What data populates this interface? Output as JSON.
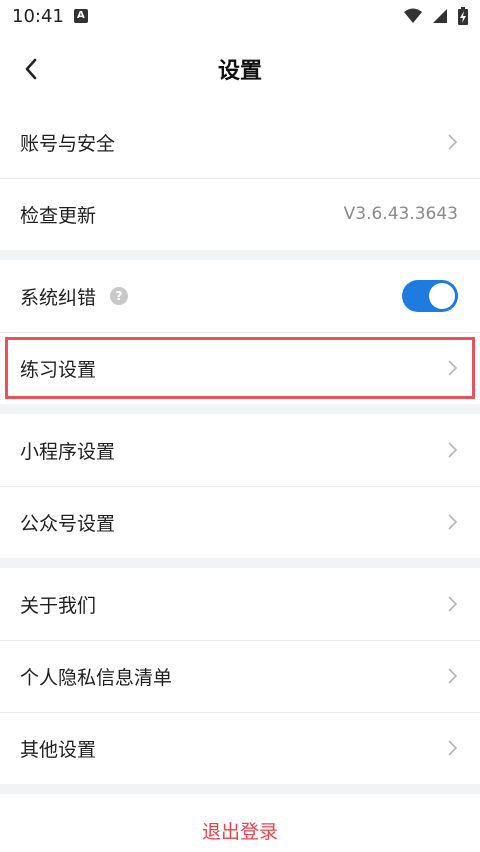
{
  "status_bar": {
    "time": "10:41",
    "notification_badge": "A"
  },
  "header": {
    "title": "设置"
  },
  "groups": [
    {
      "items": [
        {
          "label": "账号与安全",
          "type": "link"
        },
        {
          "label": "检查更新",
          "type": "value",
          "value": "V3.6.43.3643"
        }
      ]
    },
    {
      "items": [
        {
          "label": "系统纠错",
          "type": "toggle",
          "enabled": true,
          "help": "?"
        },
        {
          "label": "练习设置",
          "type": "link",
          "highlighted": true
        }
      ]
    },
    {
      "items": [
        {
          "label": "小程序设置",
          "type": "link"
        },
        {
          "label": "公众号设置",
          "type": "link"
        }
      ]
    },
    {
      "items": [
        {
          "label": "关于我们",
          "type": "link"
        },
        {
          "label": "个人隐私信息清单",
          "type": "link"
        },
        {
          "label": "其他设置",
          "type": "link"
        }
      ]
    }
  ],
  "logout": {
    "label": "退出登录"
  },
  "colors": {
    "accent": "#1e7be0",
    "highlight": "#e9525a",
    "logout": "#e8454c"
  }
}
